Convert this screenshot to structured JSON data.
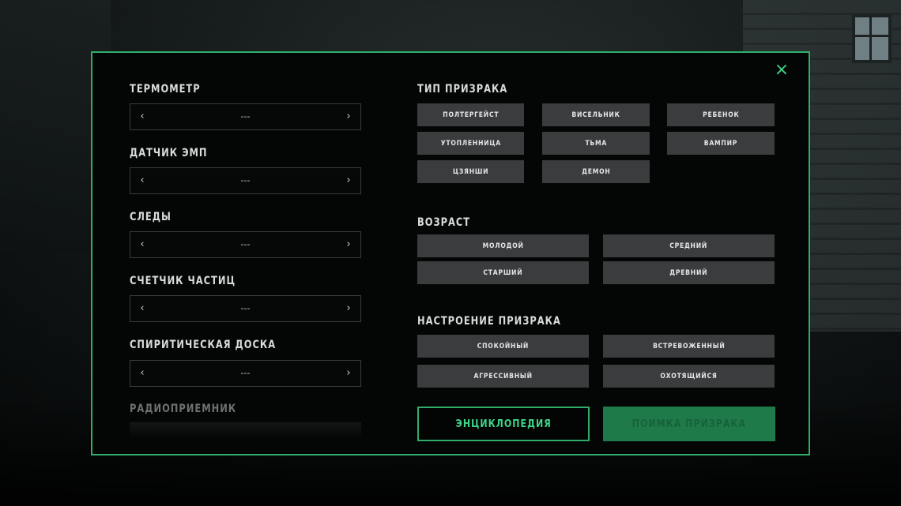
{
  "close_icon": "×",
  "left_column": {
    "selectors": [
      {
        "label": "ТЕРМОМЕТР",
        "value": "---",
        "prev": "‹",
        "next": "›"
      },
      {
        "label": "ДАТЧИК ЭМП",
        "value": "---",
        "prev": "‹",
        "next": "›"
      },
      {
        "label": "СЛЕДЫ",
        "value": "---",
        "prev": "‹",
        "next": "›"
      },
      {
        "label": "СЧЕТЧИК ЧАСТИЦ",
        "value": "---",
        "prev": "‹",
        "next": "›"
      },
      {
        "label": "СПИРИТИЧЕСКАЯ ДОСКА",
        "value": "---",
        "prev": "‹",
        "next": "›"
      }
    ],
    "faded_label": "РАДИОПРИЕМНИК"
  },
  "ghost_type": {
    "title": "ТИП ПРИЗРАКА",
    "options": [
      "ПОЛТЕРГЕЙСТ",
      "ВИСЕЛЬНИК",
      "РЕБЕНОК",
      "УТОПЛЕННИЦА",
      "ТЬМА",
      "ВАМПИР",
      "ЦЗЯНШИ",
      "ДЕМОН"
    ]
  },
  "age": {
    "title": "ВОЗРАСТ",
    "options": [
      "МОЛОДОЙ",
      "СРЕДНИЙ",
      "СТАРШИЙ",
      "ДРЕВНИЙ"
    ]
  },
  "mood": {
    "title": "НАСТРОЕНИЕ ПРИЗРАКА",
    "options": [
      "СПОКОЙНЫЙ",
      "ВСТРЕВОЖЕННЫЙ",
      "АГРЕССИВНЫЙ",
      "ОХОТЯЩИЙСЯ"
    ]
  },
  "buttons": {
    "encyclopedia": "ЭНЦИКЛОПЕДИЯ",
    "search": "ПОИМКА ПРИЗРАКА"
  },
  "colors": {
    "accent": "#2fae6a",
    "accent_text": "#3fd68a",
    "chip_bg": "#3a3c3d",
    "search_bg": "#1f7a4a"
  }
}
